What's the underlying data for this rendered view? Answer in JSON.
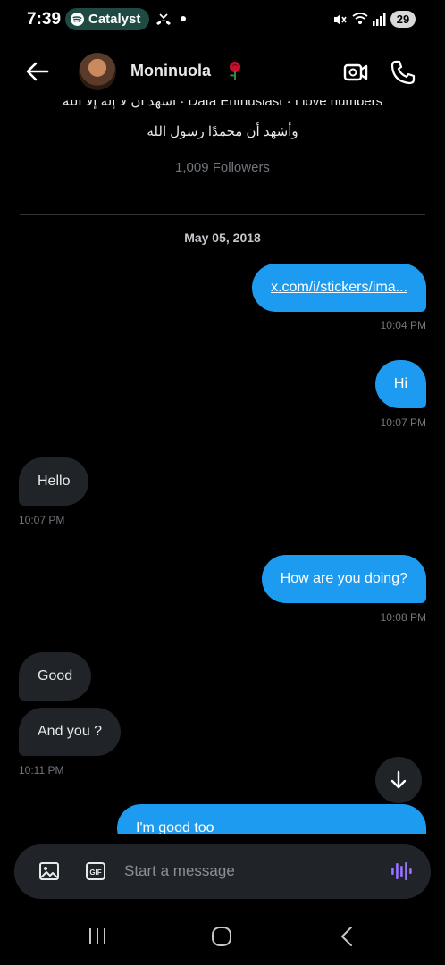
{
  "status_bar": {
    "time": "7:39",
    "media_pill_label": "Catalyst",
    "battery": "29"
  },
  "header": {
    "contact_name": "Moninuola",
    "name_emoji": "🌹"
  },
  "profile": {
    "bio_line1": "أشهد أن لا إله إلا الله · Data Enthusiast · I love numbers",
    "bio_line2": "وأشهد أن محمدًا رسول الله",
    "followers": "1,009 Followers"
  },
  "conversation": {
    "date_separator": "May 05, 2018",
    "messages": [
      {
        "dir": "sent",
        "text": "x.com/i/stickers/ima...",
        "time": "10:04 PM"
      },
      {
        "dir": "sent",
        "text": "Hi",
        "time": "10:07 PM"
      },
      {
        "dir": "received",
        "text": "Hello",
        "time": "10:07 PM"
      },
      {
        "dir": "sent",
        "text": "How are you doing?",
        "time": "10:08 PM"
      },
      {
        "dir": "received",
        "text": "Good",
        "time": ""
      },
      {
        "dir": "received",
        "text": "And you ?",
        "time": "10:11 PM"
      },
      {
        "dir": "sent",
        "text": "I'm good too",
        "time": ""
      }
    ]
  },
  "composer": {
    "placeholder": "Start a message"
  },
  "colors": {
    "accent": "#1d9bf0",
    "received_bubble": "#202327",
    "background": "#000000"
  }
}
